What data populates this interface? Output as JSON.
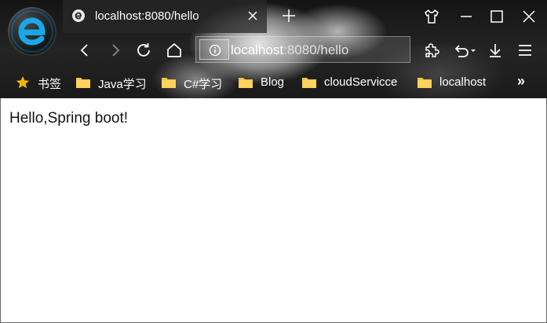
{
  "window": {
    "browser_logo": "edge-legacy-e-logo",
    "controls": [
      "tshirt-skin-icon",
      "minimize-icon",
      "maximize-icon",
      "close-icon"
    ]
  },
  "tab": {
    "title": "localhost:8080/hello",
    "favicon": "e-favicon-icon"
  },
  "address_bar": {
    "host": "localhost",
    "rest": ":8080/hello"
  },
  "toolbar": {
    "left_icons": [
      "back-icon",
      "forward-icon",
      "reload-icon",
      "home-icon"
    ],
    "right_icons": [
      "extensions-icon",
      "undo-icon",
      "download-icon",
      "menu-icon"
    ]
  },
  "bookmarks": {
    "items": [
      {
        "label": "书签",
        "icon": "star-icon"
      },
      {
        "label": "Java学习",
        "icon": "folder-icon"
      },
      {
        "label": "C#学习",
        "icon": "folder-icon"
      },
      {
        "label": "Blog",
        "icon": "folder-icon"
      },
      {
        "label": "cloudServicce",
        "icon": "folder-icon"
      },
      {
        "label": "localhost",
        "icon": "folder-icon"
      }
    ],
    "more": "»"
  },
  "page": {
    "body_text": "Hello,Spring boot!"
  },
  "colors": {
    "folder": "#f5c542",
    "star": "#f5b400",
    "page_bg": "#ffffff"
  }
}
